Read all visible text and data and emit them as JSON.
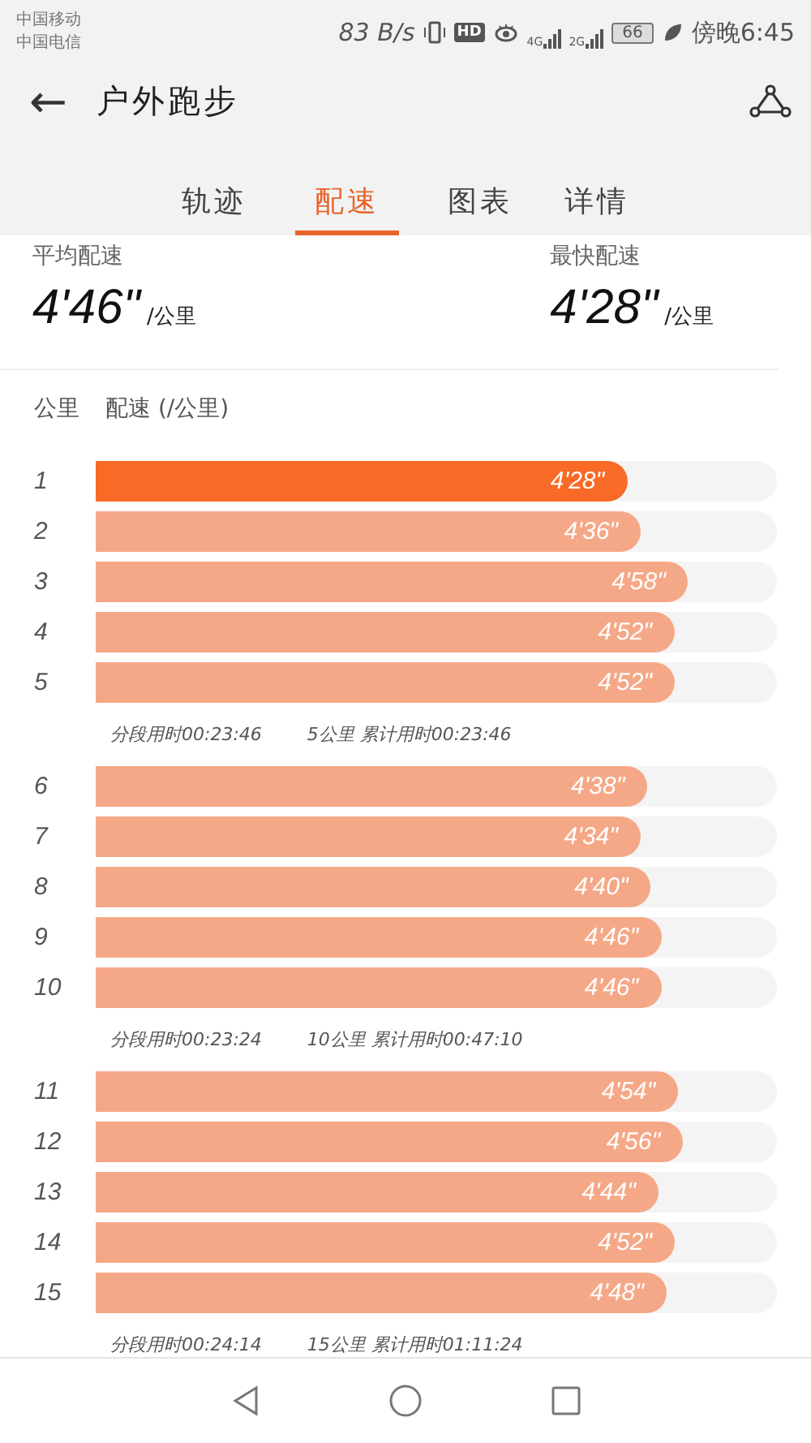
{
  "status_bar": {
    "carriers": [
      "中国移动",
      "中国电信"
    ],
    "speed": "83 B/s",
    "hd": "HD",
    "network_1": "4G",
    "network_2": "2G",
    "battery": "66",
    "time": "傍晚6:45"
  },
  "header": {
    "back": "←",
    "title": "户外跑步"
  },
  "tabs": [
    {
      "label": "轨迹",
      "selected": false
    },
    {
      "label": "配速",
      "selected": true
    },
    {
      "label": "图表",
      "selected": false
    },
    {
      "label": "详情",
      "selected": false
    }
  ],
  "summary": [
    {
      "label": "平均配速",
      "value": "4'46\"",
      "unit": "/公里"
    },
    {
      "label": "最快配速",
      "value": "4'28\"",
      "unit": "/公里"
    }
  ],
  "columns": [
    "公里",
    "配速 (/公里)"
  ],
  "groups": [
    {
      "rows": [
        {
          "km": "1",
          "pace": "4'28\"",
          "level": 0.78,
          "fastest": true
        },
        {
          "km": "2",
          "pace": "4'36\"",
          "level": 0.8,
          "fastest": false
        },
        {
          "km": "3",
          "pace": "4'58\"",
          "level": 0.87,
          "fastest": false
        },
        {
          "km": "4",
          "pace": "4'52\"",
          "level": 0.85,
          "fastest": false
        },
        {
          "km": "5",
          "pace": "4'52\"",
          "level": 0.85,
          "fastest": false
        }
      ],
      "split": "分段用时00:23:46",
      "total": "5公里 累计用时00:23:46"
    },
    {
      "rows": [
        {
          "km": "6",
          "pace": "4'38\"",
          "level": 0.81,
          "fastest": false
        },
        {
          "km": "7",
          "pace": "4'34\"",
          "level": 0.8,
          "fastest": false
        },
        {
          "km": "8",
          "pace": "4'40\"",
          "level": 0.815,
          "fastest": false
        },
        {
          "km": "9",
          "pace": "4'46\"",
          "level": 0.83,
          "fastest": false
        },
        {
          "km": "10",
          "pace": "4'46\"",
          "level": 0.83,
          "fastest": false
        }
      ],
      "split": "分段用时00:23:24",
      "total": "10公里 累计用时00:47:10"
    },
    {
      "rows": [
        {
          "km": "11",
          "pace": "4'54\"",
          "level": 0.855,
          "fastest": false
        },
        {
          "km": "12",
          "pace": "4'56\"",
          "level": 0.862,
          "fastest": false
        },
        {
          "km": "13",
          "pace": "4'44\"",
          "level": 0.826,
          "fastest": false
        },
        {
          "km": "14",
          "pace": "4'52\"",
          "level": 0.85,
          "fastest": false
        },
        {
          "km": "15",
          "pace": "4'48\"",
          "level": 0.838,
          "fastest": false
        }
      ],
      "split": "分段用时00:24:14",
      "total": "15公里 累计用时01:11:24"
    }
  ]
}
